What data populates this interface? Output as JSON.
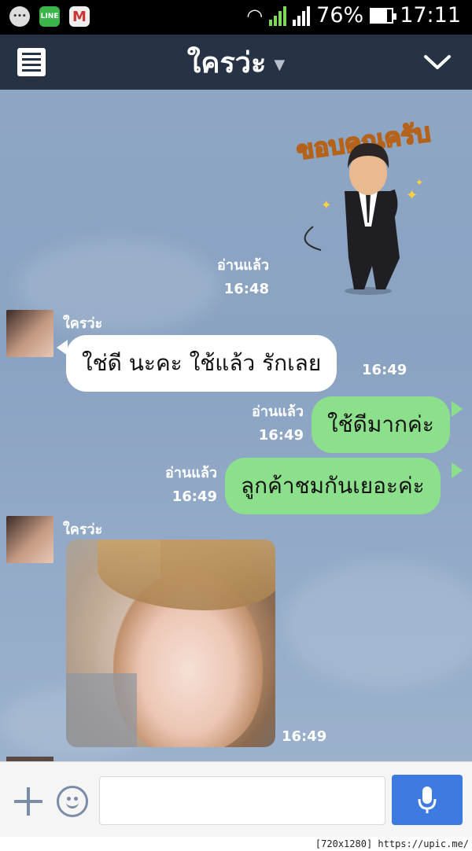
{
  "status_bar": {
    "battery": "76%",
    "time": "17:11",
    "icons": [
      "message-icon",
      "line-app-icon",
      "gmail-icon",
      "wifi-icon",
      "signal-icon",
      "battery-icon"
    ],
    "line_label": "LINE"
  },
  "header": {
    "title": "ใครว่ะ",
    "menu_icon": "list-icon",
    "collapse_icon": "chevron-down-icon"
  },
  "sticker": {
    "text": "ขอบคุณครับ",
    "read_label": "อ่านแล้ว",
    "time": "16:48"
  },
  "messages": [
    {
      "direction": "in",
      "sender": "ใครว่ะ",
      "text": "ใช่ดี นะคะ ใช้แล้ว รักเลย",
      "time": "16:49"
    },
    {
      "direction": "out",
      "text": "ใช้ดีมากค่ะ",
      "read_label": "อ่านแล้ว",
      "time": "16:49"
    },
    {
      "direction": "out",
      "text": "ลูกค้าชมกันเยอะค่ะ",
      "read_label": "อ่านแล้ว",
      "time": "16:49"
    },
    {
      "direction": "in",
      "sender": "ใครว่ะ",
      "type": "photo",
      "time": "16:49"
    }
  ],
  "input_bar": {
    "placeholder": "",
    "plus_icon": "plus-icon",
    "emoji_icon": "emoji-icon",
    "mic_icon": "microphone-icon"
  },
  "footer": "[720x1280] https://upic.me/",
  "colors": {
    "header_bg": "#273245",
    "chat_bg": "#8ea6c4",
    "out_bubble": "#8de08b",
    "in_bubble": "#ffffff",
    "mic_button": "#3d7be0"
  }
}
